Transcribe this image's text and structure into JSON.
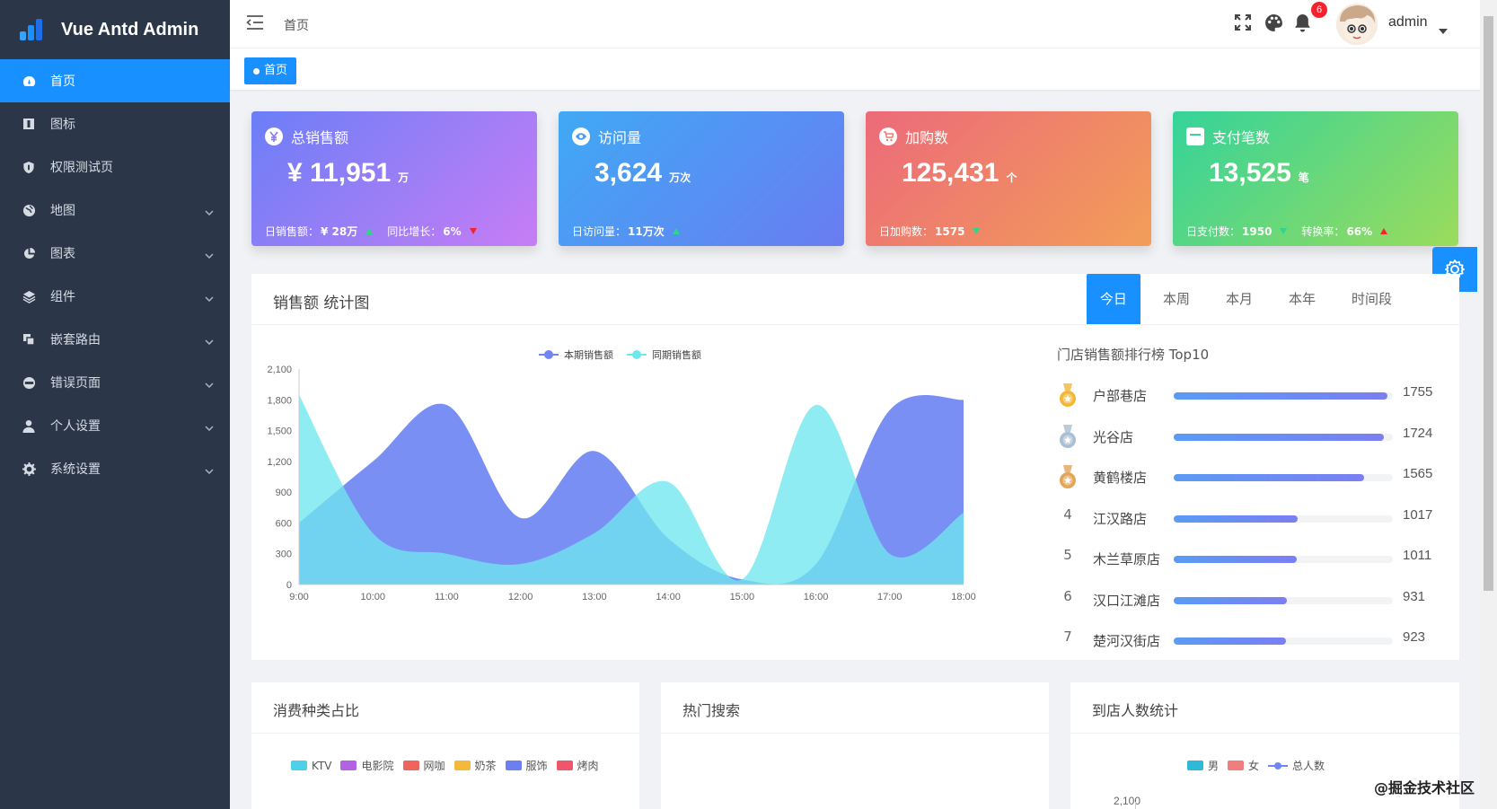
{
  "app": {
    "title": "Vue Antd Admin"
  },
  "sidebar": {
    "items": [
      {
        "label": "首页",
        "icon": "dashboard-icon",
        "active": true,
        "has_children": false
      },
      {
        "label": "图标",
        "icon": "icon-library-icon",
        "active": false,
        "has_children": false
      },
      {
        "label": "权限测试页",
        "icon": "shield-icon",
        "active": false,
        "has_children": false
      },
      {
        "label": "地图",
        "icon": "globe-icon",
        "active": false,
        "has_children": true
      },
      {
        "label": "图表",
        "icon": "pie-chart-icon",
        "active": false,
        "has_children": true
      },
      {
        "label": "组件",
        "icon": "layers-icon",
        "active": false,
        "has_children": true
      },
      {
        "label": "嵌套路由",
        "icon": "copy-icon",
        "active": false,
        "has_children": true
      },
      {
        "label": "错误页面",
        "icon": "error-icon",
        "active": false,
        "has_children": true
      },
      {
        "label": "个人设置",
        "icon": "user-icon",
        "active": false,
        "has_children": true
      },
      {
        "label": "系统设置",
        "icon": "gear-icon",
        "active": false,
        "has_children": true
      }
    ]
  },
  "header": {
    "breadcrumb": "首页",
    "notification_count": "6",
    "username": "admin"
  },
  "tags": {
    "active_tag": "首页"
  },
  "stats": [
    {
      "title": "总销售额",
      "value": "¥ 11,951",
      "unit": "万",
      "foot1_label": "日销售额：",
      "foot1_value": "¥ 28万",
      "foot2_label": "同比增长：",
      "foot2_value": "6%",
      "gradient": [
        "#6b7ef7",
        "#c77df5"
      ]
    },
    {
      "title": "访问量",
      "value": "3,624",
      "unit": "万次",
      "foot1_label": "日访问量：",
      "foot1_value": "11万次",
      "gradient": [
        "#3fa9f5",
        "#6a7cf2"
      ]
    },
    {
      "title": "加购数",
      "value": "125,431",
      "unit": "个",
      "foot1_label": "日加购数：",
      "foot1_value": "1575",
      "gradient": [
        "#ec6a7a",
        "#f29e58"
      ]
    },
    {
      "title": "支付笔数",
      "value": "13,525",
      "unit": "笔",
      "foot1_label": "日支付数：",
      "foot1_value": "1950",
      "foot2_label": "转换率：",
      "foot2_value": "66%",
      "gradient": [
        "#34d39a",
        "#9bdc5c"
      ]
    }
  ],
  "sales_panel": {
    "title": "销售额 统计图",
    "tabs": [
      "今日",
      "本周",
      "本月",
      "本年",
      "时间段"
    ],
    "active_tab": "今日",
    "rank_title": "门店销售额排行榜 Top10",
    "ranking": [
      {
        "rank": "1",
        "name": "户部巷店",
        "value": 1755,
        "medal": "gold"
      },
      {
        "rank": "2",
        "name": "光谷店",
        "value": 1724,
        "medal": "silver"
      },
      {
        "rank": "3",
        "name": "黄鹤楼店",
        "value": 1565,
        "medal": "bronze"
      },
      {
        "rank": "4",
        "name": "江汉路店",
        "value": 1017
      },
      {
        "rank": "5",
        "name": "木兰草原店",
        "value": 1011
      },
      {
        "rank": "6",
        "name": "汉口江滩店",
        "value": 931
      },
      {
        "rank": "7",
        "name": "楚河汉街店",
        "value": 923
      }
    ]
  },
  "chart_data": {
    "type": "area",
    "legend": [
      "本期销售额",
      "同期销售额"
    ],
    "legend_position": "top-center",
    "x": [
      "9:00",
      "10:00",
      "11:00",
      "12:00",
      "13:00",
      "14:00",
      "15:00",
      "16:00",
      "17:00",
      "18:00"
    ],
    "y_ticks": [
      "0",
      "300",
      "600",
      "900",
      "1,200",
      "1,500",
      "1,800",
      "2,100"
    ],
    "ylim": [
      0,
      2100
    ],
    "series": [
      {
        "name": "本期销售额",
        "color": "#6f86f2",
        "values": [
          600,
          1200,
          1750,
          650,
          1300,
          450,
          50,
          200,
          1700,
          1800
        ]
      },
      {
        "name": "同期销售额",
        "color": "#6ee7ee",
        "values": [
          1850,
          500,
          300,
          200,
          500,
          1000,
          50,
          1750,
          300,
          700
        ]
      }
    ]
  },
  "bottom_panels": [
    {
      "title": "消费种类占比",
      "legend": [
        {
          "label": "KTV",
          "color": "#4dd0e8"
        },
        {
          "label": "电影院",
          "color": "#b362e6"
        },
        {
          "label": "网咖",
          "color": "#f0645e"
        },
        {
          "label": "奶茶",
          "color": "#f4b93a"
        },
        {
          "label": "服饰",
          "color": "#6c7ff0"
        },
        {
          "label": "烤肉",
          "color": "#f0566b"
        }
      ]
    },
    {
      "title": "热门搜索"
    },
    {
      "title": "到店人数统计",
      "legend": [
        {
          "label": "男",
          "color": "#2fb9d8"
        },
        {
          "label": "女",
          "color": "#f27d7d"
        },
        {
          "label": "总人数",
          "color": "#6f86f2"
        }
      ],
      "y_top_tick": "2,100"
    }
  ],
  "watermark": "@掘金技术社区"
}
